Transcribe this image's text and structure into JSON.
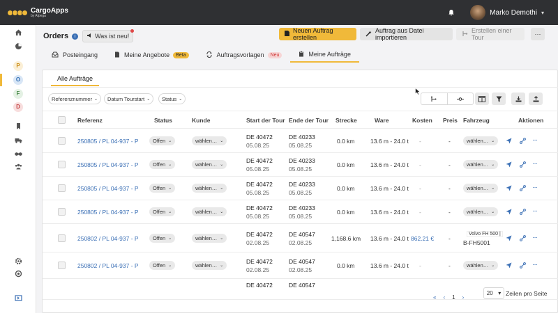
{
  "app": {
    "name": "CargoApps",
    "tagline": "by Alpega"
  },
  "user": {
    "name": "Marko Demothi"
  },
  "sidebar": {
    "letters": [
      {
        "l": "P",
        "bg": "#fbefd6",
        "fg": "#c98a12"
      },
      {
        "l": "O",
        "bg": "#d8e6f6",
        "fg": "#2f6db3"
      },
      {
        "l": "F",
        "bg": "#e4f1e4",
        "fg": "#4a8a4a"
      },
      {
        "l": "D",
        "bg": "#f8dede",
        "fg": "#c34444"
      }
    ]
  },
  "header": {
    "title": "Orders",
    "news_label": "Was ist neu!"
  },
  "buttons": {
    "new_order": "Neuen Auftrag erstellen",
    "import": "Auftrag aus Datei importieren",
    "tour": "Erstellen einer Tour",
    "more": "···"
  },
  "tabs": [
    {
      "label": "Posteingang",
      "badge": ""
    },
    {
      "label": "Meine Angebote",
      "badge": "Beta"
    },
    {
      "label": "Auftragsvorlagen",
      "badge": "Neu"
    },
    {
      "label": "Meine Aufträge",
      "badge": ""
    }
  ],
  "subtab": "Alle Aufträge",
  "filters": [
    "Referenznummer",
    "Datum Tourstart",
    "Status"
  ],
  "columns": {
    "ref": "Referenz",
    "status": "Status",
    "kunde": "Kunde",
    "start": "Start der Tour",
    "ende": "Ende der Tour",
    "strecke": "Strecke",
    "ware": "Ware",
    "kosten": "Kosten",
    "preis": "Preis",
    "fahrzeug": "Fahrzeug",
    "aktionen": "Aktionen"
  },
  "rows": [
    {
      "ref": "250805 / PL 04-937 - P",
      "status": "Offen",
      "kunde": "wählen…",
      "start": "DE 40472",
      "start_date": "05.08.25",
      "ende": "DE 40233",
      "ende_date": "05.08.25",
      "strecke": "0.0 km",
      "ware": "13.6 m - 24.0 t",
      "kosten": "-",
      "preis": "-",
      "fahrzeug": "wählen…",
      "fz_extra": ""
    },
    {
      "ref": "250805 / PL 04-937 - P",
      "status": "Offen",
      "kunde": "wählen…",
      "start": "DE 40472",
      "start_date": "05.08.25",
      "ende": "DE 40233",
      "ende_date": "05.08.25",
      "strecke": "0.0 km",
      "ware": "13.6 m - 24.0 t",
      "kosten": "-",
      "preis": "-",
      "fahrzeug": "wählen…",
      "fz_extra": ""
    },
    {
      "ref": "250805 / PL 04-937 - P",
      "status": "Offen",
      "kunde": "wählen…",
      "start": "DE 40472",
      "start_date": "05.08.25",
      "ende": "DE 40233",
      "ende_date": "05.08.25",
      "strecke": "0.0 km",
      "ware": "13.6 m - 24.0 t",
      "kosten": "-",
      "preis": "-",
      "fahrzeug": "wählen…",
      "fz_extra": ""
    },
    {
      "ref": "250805 / PL 04-937 - P",
      "status": "Offen",
      "kunde": "wählen…",
      "start": "DE 40472",
      "start_date": "05.08.25",
      "ende": "DE 40233",
      "ende_date": "05.08.25",
      "strecke": "0.0 km",
      "ware": "13.6 m - 24.0 t",
      "kosten": "-",
      "preis": "-",
      "fahrzeug": "wählen…",
      "fz_extra": ""
    },
    {
      "ref": "250802 / PL 04-937 - P",
      "status": "Offen",
      "kunde": "wählen…",
      "start": "DE 40472",
      "start_date": "02.08.25",
      "ende": "DE 40547",
      "ende_date": "02.08.25",
      "strecke": "1,168.6 km",
      "ware": "13.6 m - 24.0 t",
      "kosten": "862.21 €",
      "preis": "-",
      "fahrzeug": "Volvo FH 500 |",
      "fz_extra": "B-FH5001"
    },
    {
      "ref": "250802 / PL 04-937 - P",
      "status": "Offen",
      "kunde": "wählen…",
      "start": "DE 40472",
      "start_date": "02.08.25",
      "ende": "DE 40547",
      "ende_date": "02.08.25",
      "strecke": "0.0 km",
      "ware": "13.6 m - 24.0 t",
      "kosten": "-",
      "preis": "-",
      "fahrzeug": "wählen…",
      "fz_extra": ""
    },
    {
      "ref": "",
      "status": "",
      "kunde": "",
      "start": "DE 40472",
      "start_date": "",
      "ende": "DE 40547",
      "ende_date": "",
      "strecke": "",
      "ware": "",
      "kosten": "",
      "preis": "",
      "fahrzeug": "",
      "fz_extra": ""
    }
  ],
  "pagination": {
    "first": "«",
    "prev": "‹",
    "page": "1",
    "next": "›",
    "per_page": "20",
    "per_page_label": "Zeilen pro Seite"
  },
  "colors": {
    "accent": "#f0b93a",
    "link": "#3a6fb5",
    "topbar": "#2f3033"
  }
}
